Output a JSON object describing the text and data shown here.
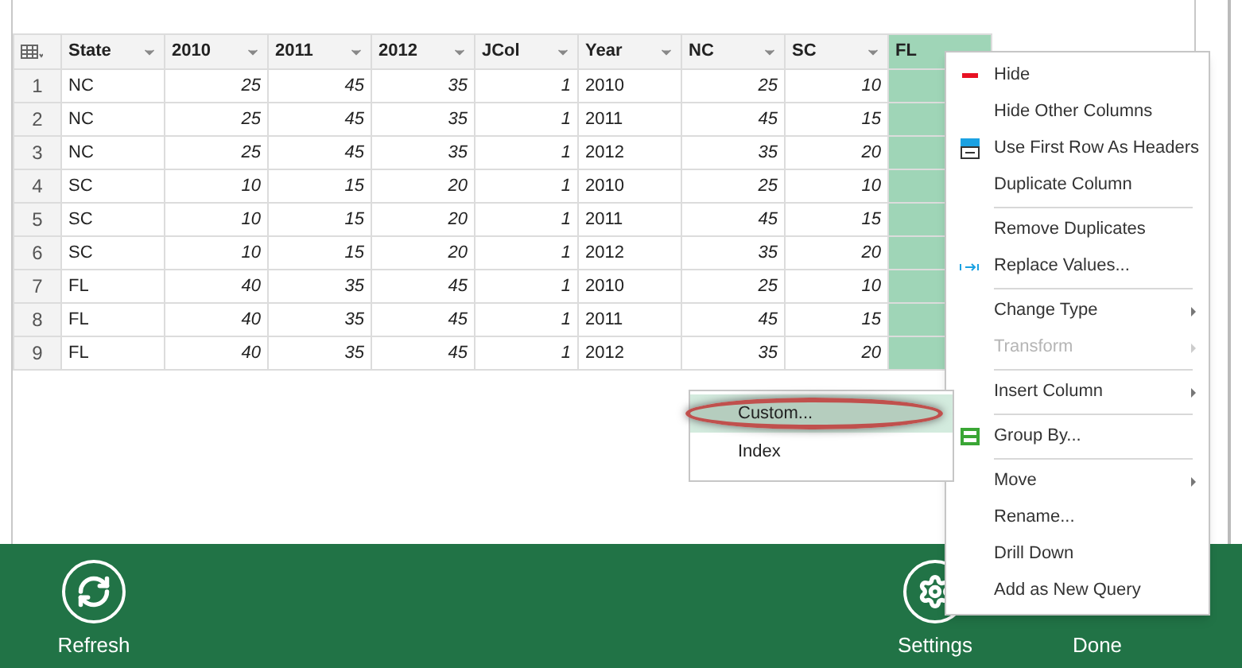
{
  "table": {
    "columns": [
      {
        "label": "State",
        "selected": false
      },
      {
        "label": "2010",
        "selected": false
      },
      {
        "label": "2011",
        "selected": false
      },
      {
        "label": "2012",
        "selected": false
      },
      {
        "label": "JCol",
        "selected": false
      },
      {
        "label": "Year",
        "selected": false
      },
      {
        "label": "NC",
        "selected": false
      },
      {
        "label": "SC",
        "selected": false
      },
      {
        "label": "FL",
        "selected": true
      }
    ],
    "rows": [
      {
        "number": "1",
        "cells": [
          "NC",
          "25",
          "45",
          "35",
          "1",
          "2010",
          "25",
          "10",
          ""
        ]
      },
      {
        "number": "2",
        "cells": [
          "NC",
          "25",
          "45",
          "35",
          "1",
          "2011",
          "45",
          "15",
          ""
        ]
      },
      {
        "number": "3",
        "cells": [
          "NC",
          "25",
          "45",
          "35",
          "1",
          "2012",
          "35",
          "20",
          ""
        ]
      },
      {
        "number": "4",
        "cells": [
          "SC",
          "10",
          "15",
          "20",
          "1",
          "2010",
          "25",
          "10",
          ""
        ]
      },
      {
        "number": "5",
        "cells": [
          "SC",
          "10",
          "15",
          "20",
          "1",
          "2011",
          "45",
          "15",
          ""
        ]
      },
      {
        "number": "6",
        "cells": [
          "SC",
          "10",
          "15",
          "20",
          "1",
          "2012",
          "35",
          "20",
          ""
        ]
      },
      {
        "number": "7",
        "cells": [
          "FL",
          "40",
          "35",
          "45",
          "1",
          "2010",
          "25",
          "10",
          ""
        ]
      },
      {
        "number": "8",
        "cells": [
          "FL",
          "40",
          "35",
          "45",
          "1",
          "2011",
          "45",
          "15",
          ""
        ]
      },
      {
        "number": "9",
        "cells": [
          "FL",
          "40",
          "35",
          "45",
          "1",
          "2012",
          "35",
          "20",
          ""
        ]
      }
    ]
  },
  "context_menu": {
    "items": [
      {
        "kind": "dash",
        "label": "Hide",
        "disabled": false
      },
      {
        "kind": "plain",
        "label": "Hide Other Columns",
        "disabled": false
      },
      {
        "kind": "header",
        "label": "Use First Row As Headers",
        "disabled": false
      },
      {
        "kind": "plain",
        "label": "Duplicate Column",
        "disabled": false
      },
      {
        "kind": "separator"
      },
      {
        "kind": "plain",
        "label": "Remove Duplicates",
        "disabled": false
      },
      {
        "kind": "replace",
        "label": "Replace Values...",
        "disabled": false
      },
      {
        "kind": "separator"
      },
      {
        "kind": "submenu",
        "label": "Change Type",
        "disabled": false
      },
      {
        "kind": "submenu",
        "label": "Transform",
        "disabled": true
      },
      {
        "kind": "separator"
      },
      {
        "kind": "submenu",
        "label": "Insert Column",
        "disabled": false
      },
      {
        "kind": "separator"
      },
      {
        "kind": "group",
        "label": "Group By...",
        "disabled": false
      },
      {
        "kind": "separator"
      },
      {
        "kind": "submenu",
        "label": "Move",
        "disabled": false
      },
      {
        "kind": "plain",
        "label": "Rename...",
        "disabled": false
      },
      {
        "kind": "plain",
        "label": "Drill Down",
        "disabled": false
      },
      {
        "kind": "plain",
        "label": "Add as New Query",
        "disabled": false
      }
    ]
  },
  "submenu": {
    "items": [
      {
        "label": "Custom...",
        "selected": true,
        "circled": true
      },
      {
        "label": "Index",
        "selected": false,
        "circled": false
      }
    ]
  },
  "footer": {
    "buttons": [
      {
        "kind": "refresh",
        "label": "Refresh"
      },
      {
        "kind": "gear",
        "label": "Settings"
      },
      {
        "kind": "covered",
        "label": "Done"
      }
    ]
  }
}
